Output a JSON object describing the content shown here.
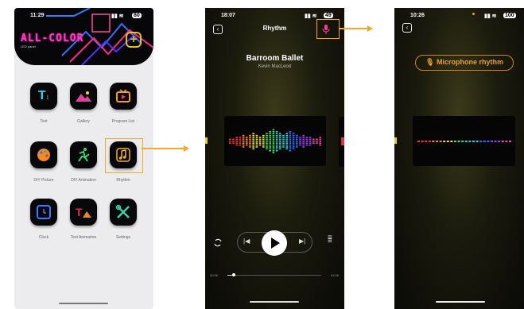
{
  "phone1": {
    "status_time": "11:29",
    "status_battery": "80",
    "logo": "ALL-COLOR",
    "logo_sub": "LED panel",
    "grid": [
      {
        "label": "Text",
        "icon": "text-icon"
      },
      {
        "label": "Gallery",
        "icon": "gallery-icon"
      },
      {
        "label": "Program List",
        "icon": "program-list-icon"
      },
      {
        "label": "DIY Picture",
        "icon": "diy-picture-icon"
      },
      {
        "label": "DIY Animation",
        "icon": "diy-animation-icon"
      },
      {
        "label": "Rhythm",
        "icon": "music-note-icon"
      },
      {
        "label": "Clock",
        "icon": "clock-icon"
      },
      {
        "label": "Text Animation",
        "icon": "text-animation-icon"
      },
      {
        "label": "Settings",
        "icon": "settings-icon"
      }
    ]
  },
  "phone2": {
    "status_time": "18:07",
    "status_battery": "49",
    "title": "Rhythm",
    "song_title": "Barroom Ballet",
    "artist": "Kevin MacLeod",
    "time_start": "00:06",
    "time_end": "03:06"
  },
  "phone3": {
    "status_time": "10:26",
    "status_battery": "100",
    "mic_button": "Microphone rhythm"
  },
  "colors": {
    "highlight": "#f4a928",
    "mic_pink": "#ff3c9a",
    "accent_gold": "#d8c430"
  }
}
